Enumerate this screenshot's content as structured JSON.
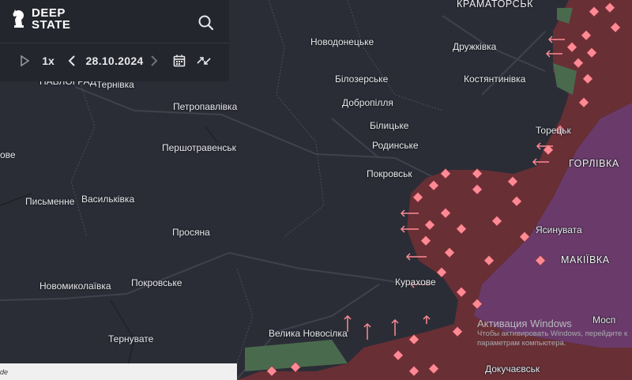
{
  "app": {
    "logo_line1": "DEEP",
    "logo_line2": "STATE"
  },
  "toolbar": {
    "speed_label": "1x",
    "date_value": "28.10.2024"
  },
  "icons": {
    "logo": "knight-chess-icon",
    "search": "search-icon",
    "play": "play-icon",
    "prev": "chevron-left-icon",
    "next": "chevron-right-icon",
    "calendar": "calendar-icon",
    "compare": "compare-arrows-icon"
  },
  "map": {
    "labels": {
      "kramatorsk": "КРАМАТОРСЬК",
      "novodonetske": "Новодонецьке",
      "druzhkivka": "Дружківка",
      "nikolaivka": "НАВЛОГРАД",
      "ternivka": "Тернівка",
      "bilozerske": "Білозерське",
      "kostiantynivka": "Костянтинівка",
      "petropavlivka": "Петропавлівка",
      "dobropillia": "Добропілля",
      "bilytske": "Білицьке",
      "toretsk": "Торецьк",
      "pershotravensk": "Першотравенськ",
      "rodynske": "Родинське",
      "ove": "ове",
      "horlivka": "ГОРЛІВКА",
      "pokrovsk": "Покровськ",
      "pysmenne": "Письменне",
      "vasylkivka": "Васильківка",
      "prosiana": "Просяна",
      "yasynuvata": "Ясинувата",
      "makiivka": "МАКІЇВКА",
      "novomykolaivka": "Новомиколаївка",
      "pokrovske": "Покровське",
      "kurakhove": "Курахове",
      "ternuvate": "Тернувате",
      "velyka_novosilka": "Велика Новосілка",
      "mospyne": "Мосп",
      "dokuchaievsk": "Докучаєвськ",
      "bottom_left": "de"
    },
    "colors": {
      "background": "#2b2d36",
      "occupied": "#6b2f36",
      "occupied_long": "#6a3b6a",
      "contested_marker": "#ff8a94",
      "liberated": "#4a6a4e"
    }
  },
  "windows_watermark": {
    "title": "Активация Windows",
    "line1": "Чтобы активировать Windows, перейдите к",
    "line2": "параметрам компьютера."
  }
}
